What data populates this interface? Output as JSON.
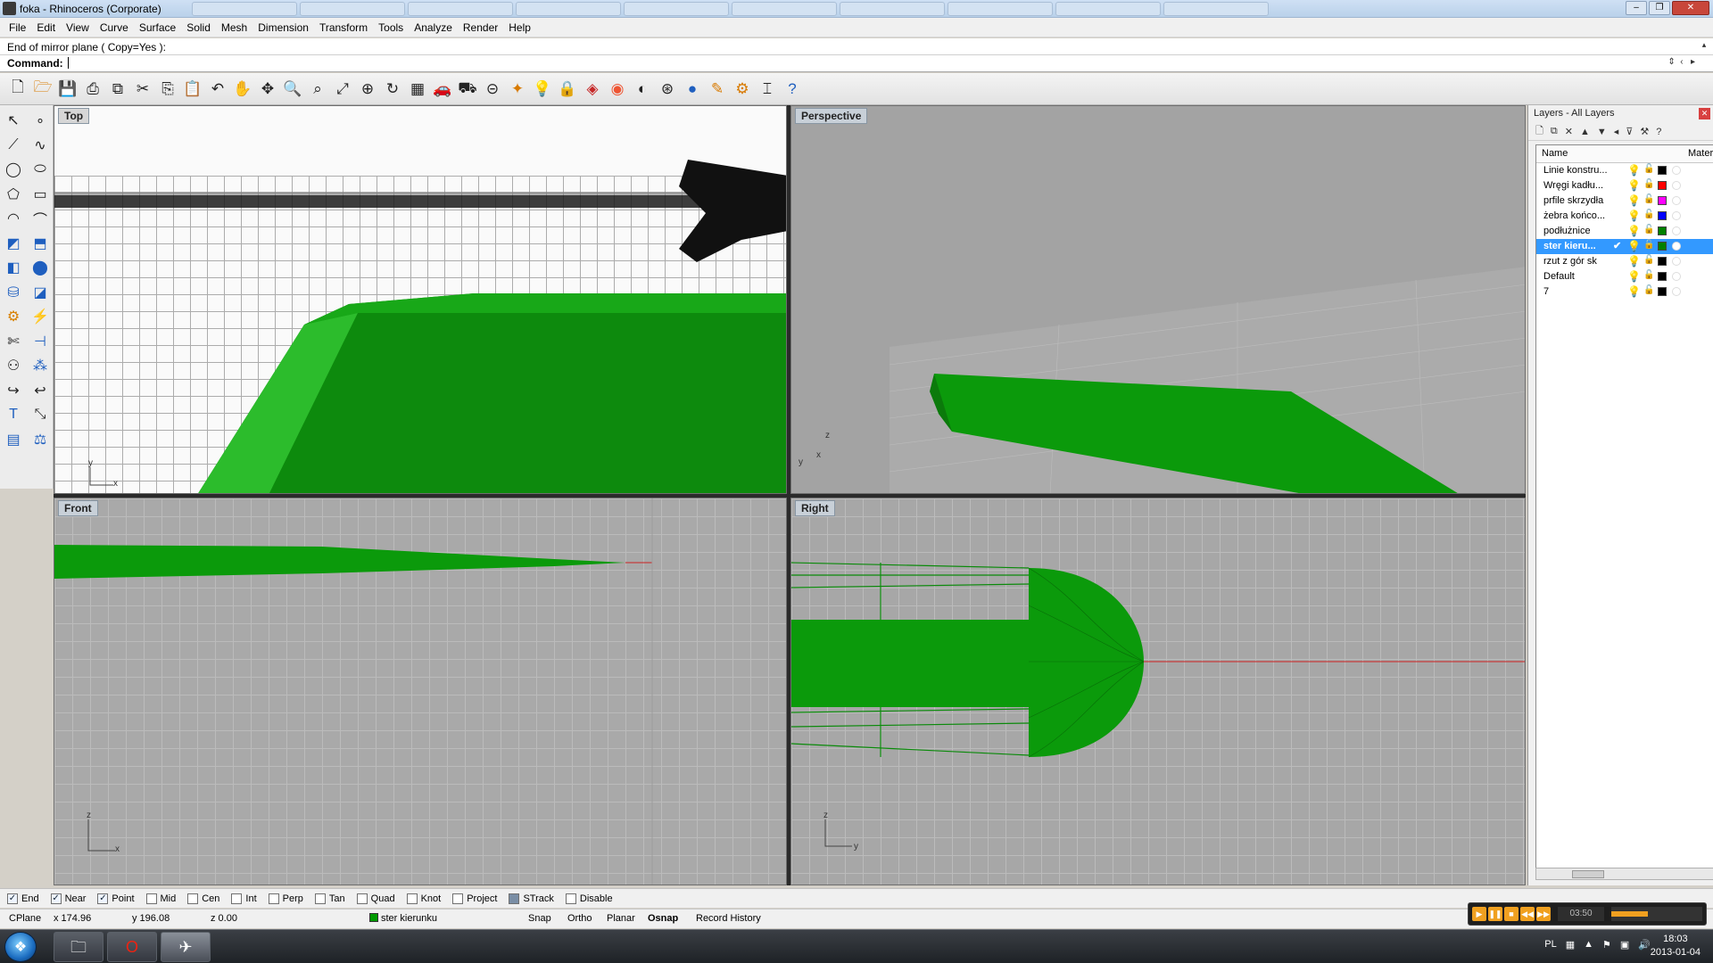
{
  "window": {
    "title": "foka - Rhinoceros (Corporate)",
    "browser_tabs": [
      "",
      "",
      "",
      "",
      "",
      "",
      "",
      "",
      "",
      "",
      "",
      "",
      ""
    ]
  },
  "menu": [
    "File",
    "Edit",
    "View",
    "Curve",
    "Surface",
    "Solid",
    "Mesh",
    "Dimension",
    "Transform",
    "Tools",
    "Analyze",
    "Render",
    "Help"
  ],
  "command": {
    "history": "End of mirror plane ( Copy=Yes ):",
    "prompt_label": "Command:",
    "value": ""
  },
  "toolbar_icons": [
    "new-file-icon",
    "open-file-icon",
    "save-icon",
    "print-icon",
    "import-icon",
    "cut-icon",
    "copy-icon",
    "paste-icon",
    "undo-icon",
    "pan-icon",
    "rotate-view-icon",
    "zoom-icon",
    "zoom-window-icon",
    "zoom-extents-icon",
    "zoom-selected-icon",
    "undo-view-icon",
    "four-viewports-icon",
    "car-icon",
    "car-wire-icon",
    "cplane-icon",
    "osnap-icon",
    "light-icon",
    "lock-icon",
    "layer-icon",
    "color-wheel-icon",
    "render-sphere-icon",
    "wire-sphere-icon",
    "render-icon",
    "properties-icon",
    "options-icon",
    "dimension-icon",
    "help-icon"
  ],
  "left_tools": [
    "select-arrow-icon",
    "point-icon",
    "polyline-icon",
    "curve-icon",
    "circle-icon",
    "ellipse-icon",
    "polygon-icon",
    "rectangle-icon",
    "arc-icon",
    "fillet-icon",
    "surface-icon",
    "extrude-icon",
    "box-icon",
    "boolean-icon",
    "cylinder-icon",
    "shell-icon",
    "gear-icon",
    "edit-points-icon",
    "split-icon",
    "dimension-icon",
    "group-icon",
    "transform-icon",
    "text-icon",
    "scale-icon",
    "array-icon",
    "orient-icon",
    "solid-box-icon",
    "analyze-icon"
  ],
  "viewports": {
    "top": {
      "label": "Top",
      "axis_x": "x",
      "axis_y": "y"
    },
    "perspective": {
      "label": "Perspective",
      "axis_x": "x",
      "axis_y": "y",
      "axis_z": "z"
    },
    "front": {
      "label": "Front",
      "axis_x": "x",
      "axis_z": "z"
    },
    "right": {
      "label": "Right",
      "axis_y": "y",
      "axis_z": "z"
    }
  },
  "layers_panel": {
    "title": "Layers - All Layers",
    "col_name": "Name",
    "col_material": "Mater",
    "layers": [
      {
        "name": "Linie konstru...",
        "current": false,
        "visible": true,
        "color": "#000000"
      },
      {
        "name": "Wręgi kadłu...",
        "current": false,
        "visible": true,
        "color": "#ff0000"
      },
      {
        "name": "prfile skrzydła",
        "current": false,
        "visible": true,
        "color": "#ff00ff"
      },
      {
        "name": "żebra końco...",
        "current": false,
        "visible": true,
        "color": "#0000ff"
      },
      {
        "name": "podłużnice",
        "current": false,
        "visible": true,
        "color": "#008000"
      },
      {
        "name": "ster kieru...",
        "current": true,
        "visible": true,
        "color": "#008000"
      },
      {
        "name": "rzut z gór sk",
        "current": false,
        "visible": false,
        "color": "#000000"
      },
      {
        "name": "Default",
        "current": false,
        "visible": true,
        "color": "#000000"
      },
      {
        "name": "7",
        "current": false,
        "visible": false,
        "color": "#000000"
      }
    ],
    "current_mark": "✔"
  },
  "osnaps": [
    {
      "label": "End",
      "checked": true
    },
    {
      "label": "Near",
      "checked": true
    },
    {
      "label": "Point",
      "checked": true
    },
    {
      "label": "Mid",
      "checked": false
    },
    {
      "label": "Cen",
      "checked": false
    },
    {
      "label": "Int",
      "checked": false
    },
    {
      "label": "Perp",
      "checked": false
    },
    {
      "label": "Tan",
      "checked": false
    },
    {
      "label": "Quad",
      "checked": false
    },
    {
      "label": "Knot",
      "checked": false
    },
    {
      "label": "Project",
      "checked": false
    },
    {
      "label": "STrack",
      "checked": true
    },
    {
      "label": "Disable",
      "checked": false
    }
  ],
  "status": {
    "cplane": "CPlane",
    "x": "x 174.96",
    "y": "y 196.08",
    "z": "z 0.00",
    "layer": "ster kierunku",
    "snap": "Snap",
    "ortho": "Ortho",
    "planar": "Planar",
    "osnap": "Osnap",
    "record_history": "Record History"
  },
  "media": {
    "time": "03:50"
  },
  "taskbar": {
    "lang": "PL",
    "time": "18:03",
    "date": "2013-01-04"
  },
  "colors": {
    "model_green": "#0a9a0a",
    "selection_blue": "#3399ff"
  }
}
